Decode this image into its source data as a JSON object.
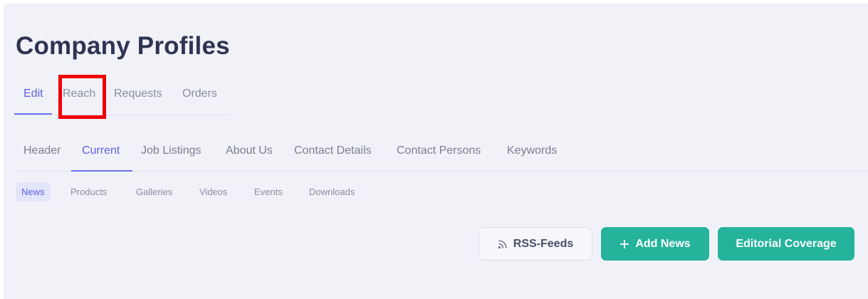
{
  "page_title": "Company Profiles",
  "tabs_top": [
    {
      "label": "Edit",
      "active": true
    },
    {
      "label": "Reach",
      "active": false
    },
    {
      "label": "Requests",
      "active": false
    },
    {
      "label": "Orders",
      "active": false
    }
  ],
  "tabs_secondary": [
    {
      "label": "Header",
      "active": false
    },
    {
      "label": "Current",
      "active": true
    },
    {
      "label": "Job Listings",
      "active": false
    },
    {
      "label": "About Us",
      "active": false
    },
    {
      "label": "Contact Details",
      "active": false
    },
    {
      "label": "Contact Persons",
      "active": false
    },
    {
      "label": "Keywords",
      "active": false
    }
  ],
  "tabs_tertiary": [
    {
      "label": "News",
      "active": true
    },
    {
      "label": "Products",
      "active": false
    },
    {
      "label": "Galleries",
      "active": false
    },
    {
      "label": "Videos",
      "active": false
    },
    {
      "label": "Events",
      "active": false
    },
    {
      "label": "Downloads",
      "active": false
    }
  ],
  "actions": {
    "rss_label": "RSS-Feeds",
    "rss_icon": "rss-icon",
    "add_news_label": "Add News",
    "add_news_icon": "plus-icon",
    "editorial_label": "Editorial Coverage"
  },
  "colors": {
    "accent": "#5b63e6",
    "teal_button": "#25b39c",
    "highlight": "#ee0000",
    "title": "#2e3452"
  }
}
